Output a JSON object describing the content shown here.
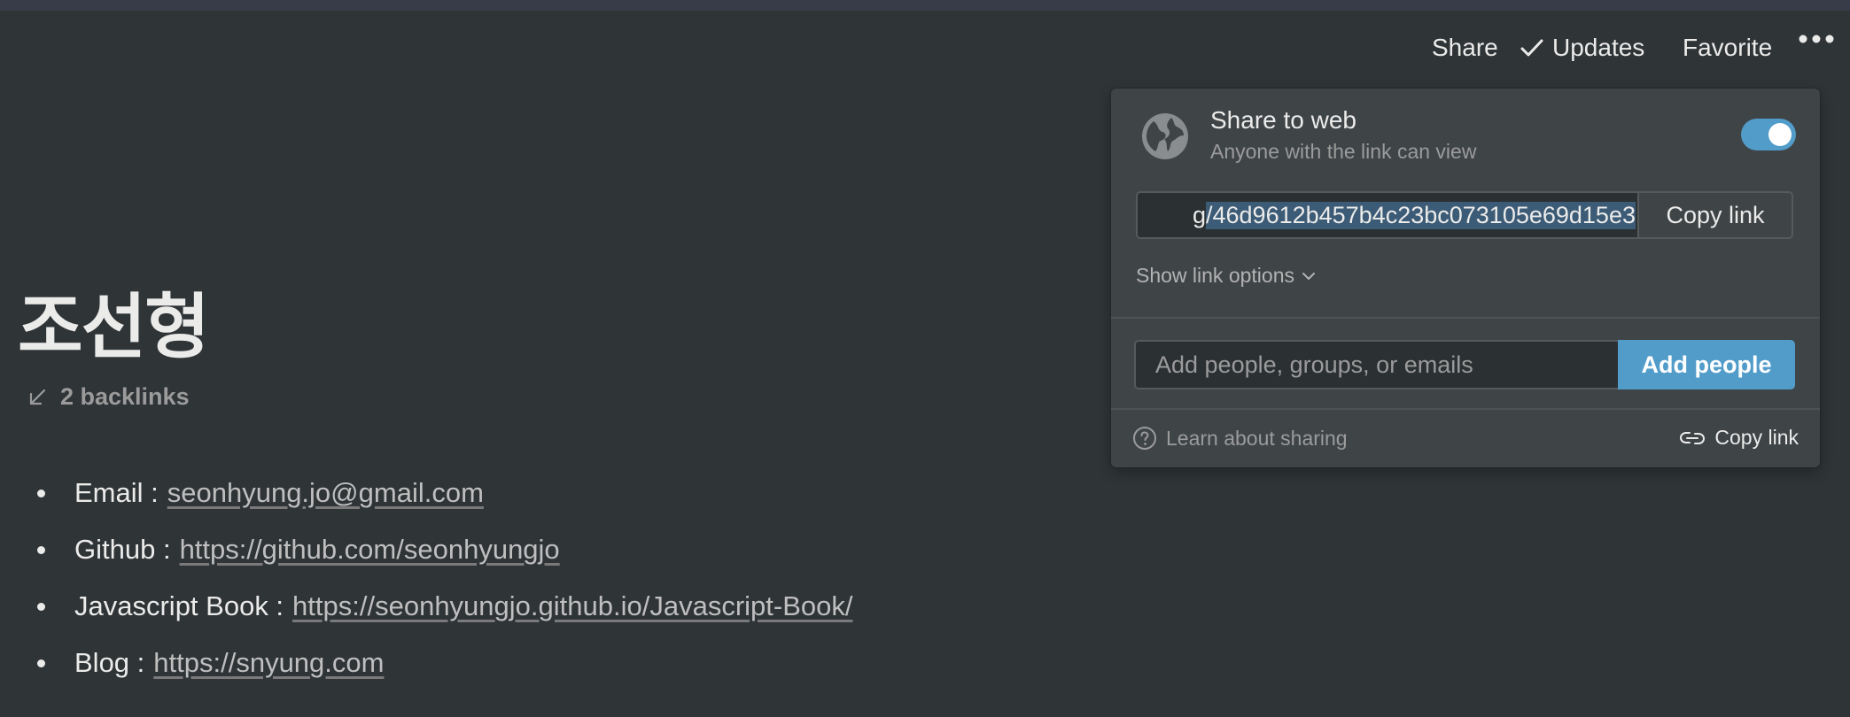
{
  "topbar": {
    "share_label": "Share",
    "updates_label": "Updates",
    "favorite_label": "Favorite",
    "more_icon": "more-horizontal-icon"
  },
  "page": {
    "title": "조선형",
    "backlinks": "2 backlinks",
    "items": [
      {
        "label": "Email :",
        "link": "seonhyung.jo@gmail.com"
      },
      {
        "label": "Github :",
        "link": "https://github.com/seonhyungjo"
      },
      {
        "label": "Javascript Book :",
        "link": "https://seonhyungjo.github.io/Javascript-Book/"
      },
      {
        "label": "Blog :",
        "link": "https://snyung.com"
      }
    ]
  },
  "share_popover": {
    "title": "Share to web",
    "subtitle": "Anyone with the link can view",
    "toggle_on": true,
    "link_prefix": "g",
    "link_selected": "/46d9612b457b4c23bc073105e69d15e3",
    "copy_link_label": "Copy link",
    "show_link_options": "Show link options",
    "add_people_placeholder": "Add people, groups, or emails",
    "add_people_label": "Add people",
    "learn_about_sharing": "Learn about sharing",
    "footer_copy_link": "Copy link"
  },
  "colors": {
    "background": "#2f3437",
    "popover": "#3f4447",
    "accent": "#529cca",
    "selection": "#3c5b76"
  }
}
